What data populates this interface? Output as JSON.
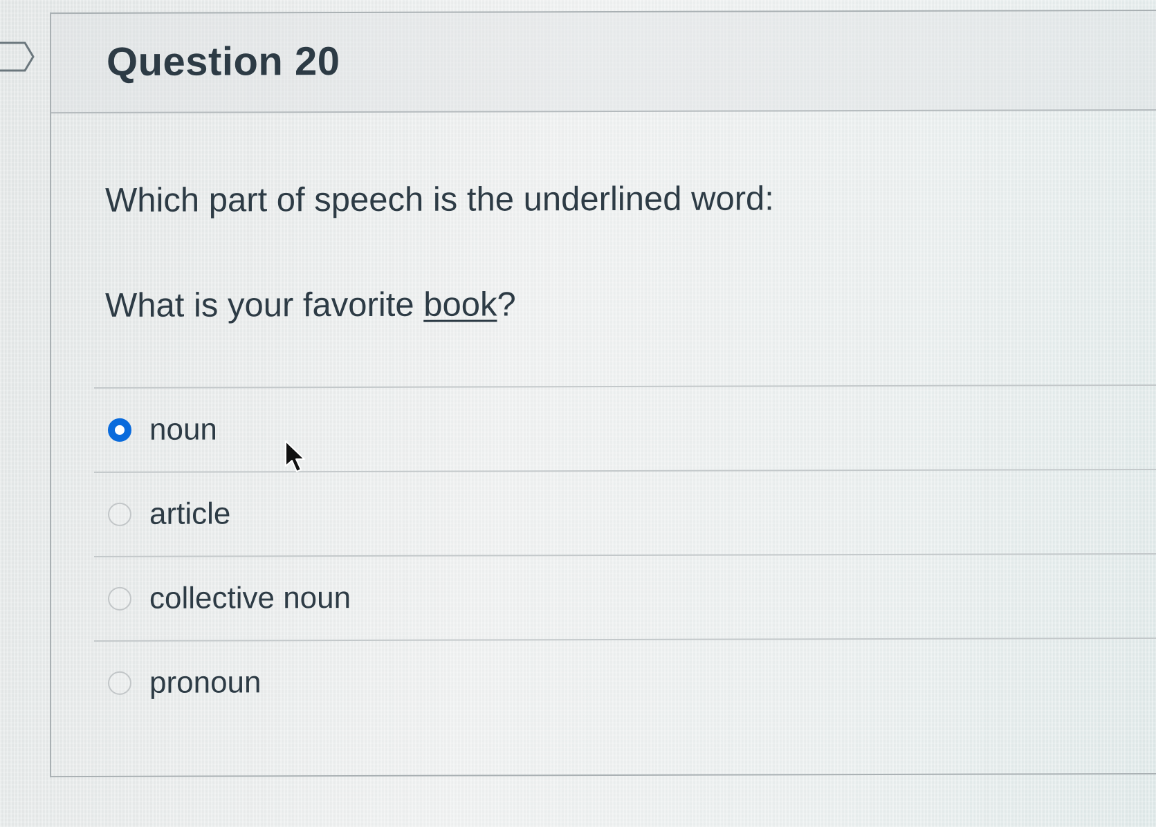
{
  "question": {
    "title": "Question 20",
    "prompt": "Which part of speech is the underlined word:",
    "sentence_before": "What is your favorite ",
    "sentence_underlined": "book",
    "sentence_after": "?"
  },
  "answers": [
    {
      "label": "noun",
      "selected": true
    },
    {
      "label": "article",
      "selected": false
    },
    {
      "label": "collective noun",
      "selected": false
    },
    {
      "label": "pronoun",
      "selected": false
    }
  ],
  "colors": {
    "selected_radio": "#0a6bdc",
    "text": "#2d3b45",
    "border": "#a9b0b3"
  },
  "icons": {
    "flag": "flag-marker-icon",
    "cursor": "mouse-pointer-icon"
  }
}
